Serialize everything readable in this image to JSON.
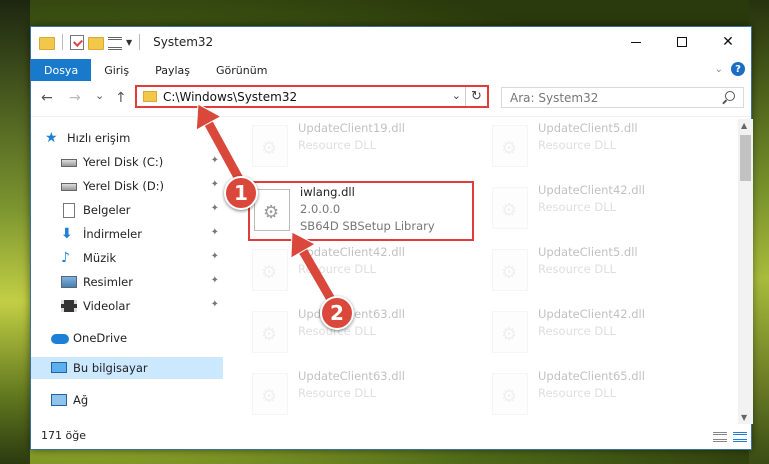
{
  "window": {
    "title": "System32",
    "minimize_glyph": "—",
    "maximize_glyph": "☐",
    "close_glyph": "✕"
  },
  "ribbon": {
    "tabs": [
      {
        "label": "Dosya",
        "active": true
      },
      {
        "label": "Giriş",
        "active": false
      },
      {
        "label": "Paylaş",
        "active": false
      },
      {
        "label": "Görünüm",
        "active": false
      }
    ],
    "help": "?"
  },
  "nav": {
    "back": "←",
    "forward": "→",
    "recent": "⌄",
    "up": "↑",
    "address": "C:\\Windows\\System32",
    "address_dropdown": "⌄",
    "refresh": "↻"
  },
  "search": {
    "placeholder": "Ara: System32"
  },
  "sidebar": {
    "items": [
      {
        "label": "Hızlı erişim",
        "icon": "star-icon",
        "pinned": false
      },
      {
        "label": "Yerel Disk (C:)",
        "icon": "drive-icon",
        "pinned": true
      },
      {
        "label": "Yerel Disk (D:)",
        "icon": "drive-icon",
        "pinned": true
      },
      {
        "label": "Belgeler",
        "icon": "document-icon",
        "pinned": true
      },
      {
        "label": "İndirmeler",
        "icon": "download-icon",
        "pinned": true
      },
      {
        "label": "Müzik",
        "icon": "music-icon",
        "pinned": true
      },
      {
        "label": "Resimler",
        "icon": "pictures-icon",
        "pinned": true
      },
      {
        "label": "Videolar",
        "icon": "video-icon",
        "pinned": true
      },
      {
        "label": "OneDrive",
        "icon": "cloud-icon",
        "pinned": false
      },
      {
        "label": "Bu bilgisayar",
        "icon": "computer-icon",
        "pinned": false,
        "selected": true
      },
      {
        "label": "Ağ",
        "icon": "network-icon",
        "pinned": false
      }
    ],
    "pin_glyph": "📌"
  },
  "files": [
    {
      "name": "UpdateClient19.dll",
      "type": "Resource DLL"
    },
    {
      "name": "UpdateClient5.dll",
      "type": "Resource DLL"
    },
    {
      "name": "iwlang.dll",
      "type": "2.0.0.0",
      "desc": "SB64D SBSetup Library",
      "highlighted": true
    },
    {
      "name": "UpdateClient42.dll",
      "type": "Resource DLL"
    },
    {
      "name": "UpdateClient42.dll",
      "type": "Resource DLL"
    },
    {
      "name": "UpdateClient5.dll",
      "type": "Resource DLL"
    },
    {
      "name": "UpdateClient63.dll",
      "type": "Resource DLL"
    },
    {
      "name": "UpdateClient42.dll",
      "type": "Resource DLL"
    },
    {
      "name": "UpdateClient63.dll",
      "type": "Resource DLL"
    },
    {
      "name": "UpdateClient65.dll",
      "type": "Resource DLL"
    }
  ],
  "status": {
    "count": "171 öğe"
  },
  "annotations": {
    "step1": "1",
    "step2": "2",
    "arrow_color": "#d9483b"
  },
  "scroll": {
    "up": "▲",
    "down": "▼"
  }
}
